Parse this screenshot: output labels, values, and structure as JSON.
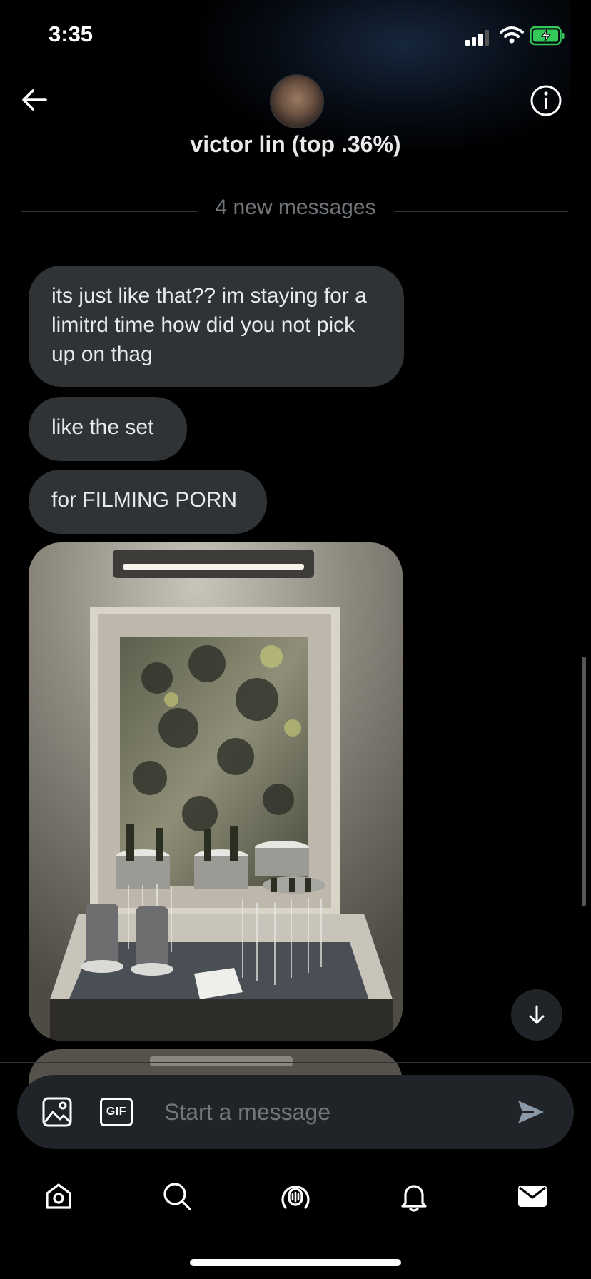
{
  "status_bar": {
    "time": "3:35",
    "icons": [
      "cellular-signal-icon",
      "wifi-icon",
      "battery-charging-icon"
    ]
  },
  "header": {
    "title": "victor lin (top .36%)",
    "back_icon": "arrow-left-icon",
    "info_icon": "info-icon"
  },
  "divider": {
    "label": "4 new messages"
  },
  "messages": [
    {
      "text": "its just like that?? im staying for a limitrd time how did you not pick up on thag"
    },
    {
      "text": "like the set"
    },
    {
      "text": "for FILMING PORN"
    }
  ],
  "composer": {
    "placeholder": "Start a message",
    "gif_label": "GIF"
  },
  "tabs": [
    "home-icon",
    "search-icon",
    "spaces-icon",
    "notifications-icon",
    "messages-icon"
  ],
  "colors": {
    "background": "#000000",
    "bubble": "#2f3336",
    "composer": "#202327",
    "muted_text": "#71767b",
    "accent": "#1d9bf0"
  }
}
